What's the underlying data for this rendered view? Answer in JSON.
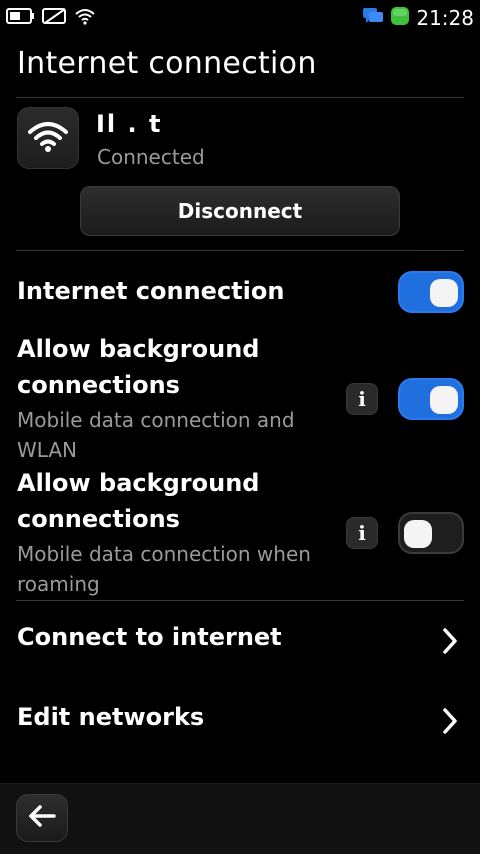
{
  "status_bar": {
    "time": "21:28",
    "icons": [
      "battery-icon",
      "no-sim-icon",
      "wifi-icon",
      "chat-icon",
      "online-status-icon"
    ]
  },
  "page": {
    "title": "Internet connection"
  },
  "network": {
    "name": "Il    .    t",
    "status": "Connected",
    "icon": "wifi-icon",
    "disconnect_label": "Disconnect"
  },
  "settings": {
    "internet_connection": {
      "label": "Internet connection",
      "enabled": true
    },
    "background_wlan": {
      "title_line1": "Allow background",
      "title_line2": "connections",
      "sub_line1": "Mobile data connection and",
      "sub_line2": "WLAN",
      "enabled": true
    },
    "background_roaming": {
      "title_line1": "Allow background",
      "title_line2": "connections",
      "sub_line1": "Mobile data connection when",
      "sub_line2": "roaming",
      "enabled": false
    },
    "info_glyph": "i"
  },
  "nav": [
    {
      "label": "Connect to internet"
    },
    {
      "label": "Edit networks"
    }
  ],
  "colors": {
    "accent": "#1f6fde",
    "background": "#000000",
    "secondary_text": "#9a9a9a"
  }
}
